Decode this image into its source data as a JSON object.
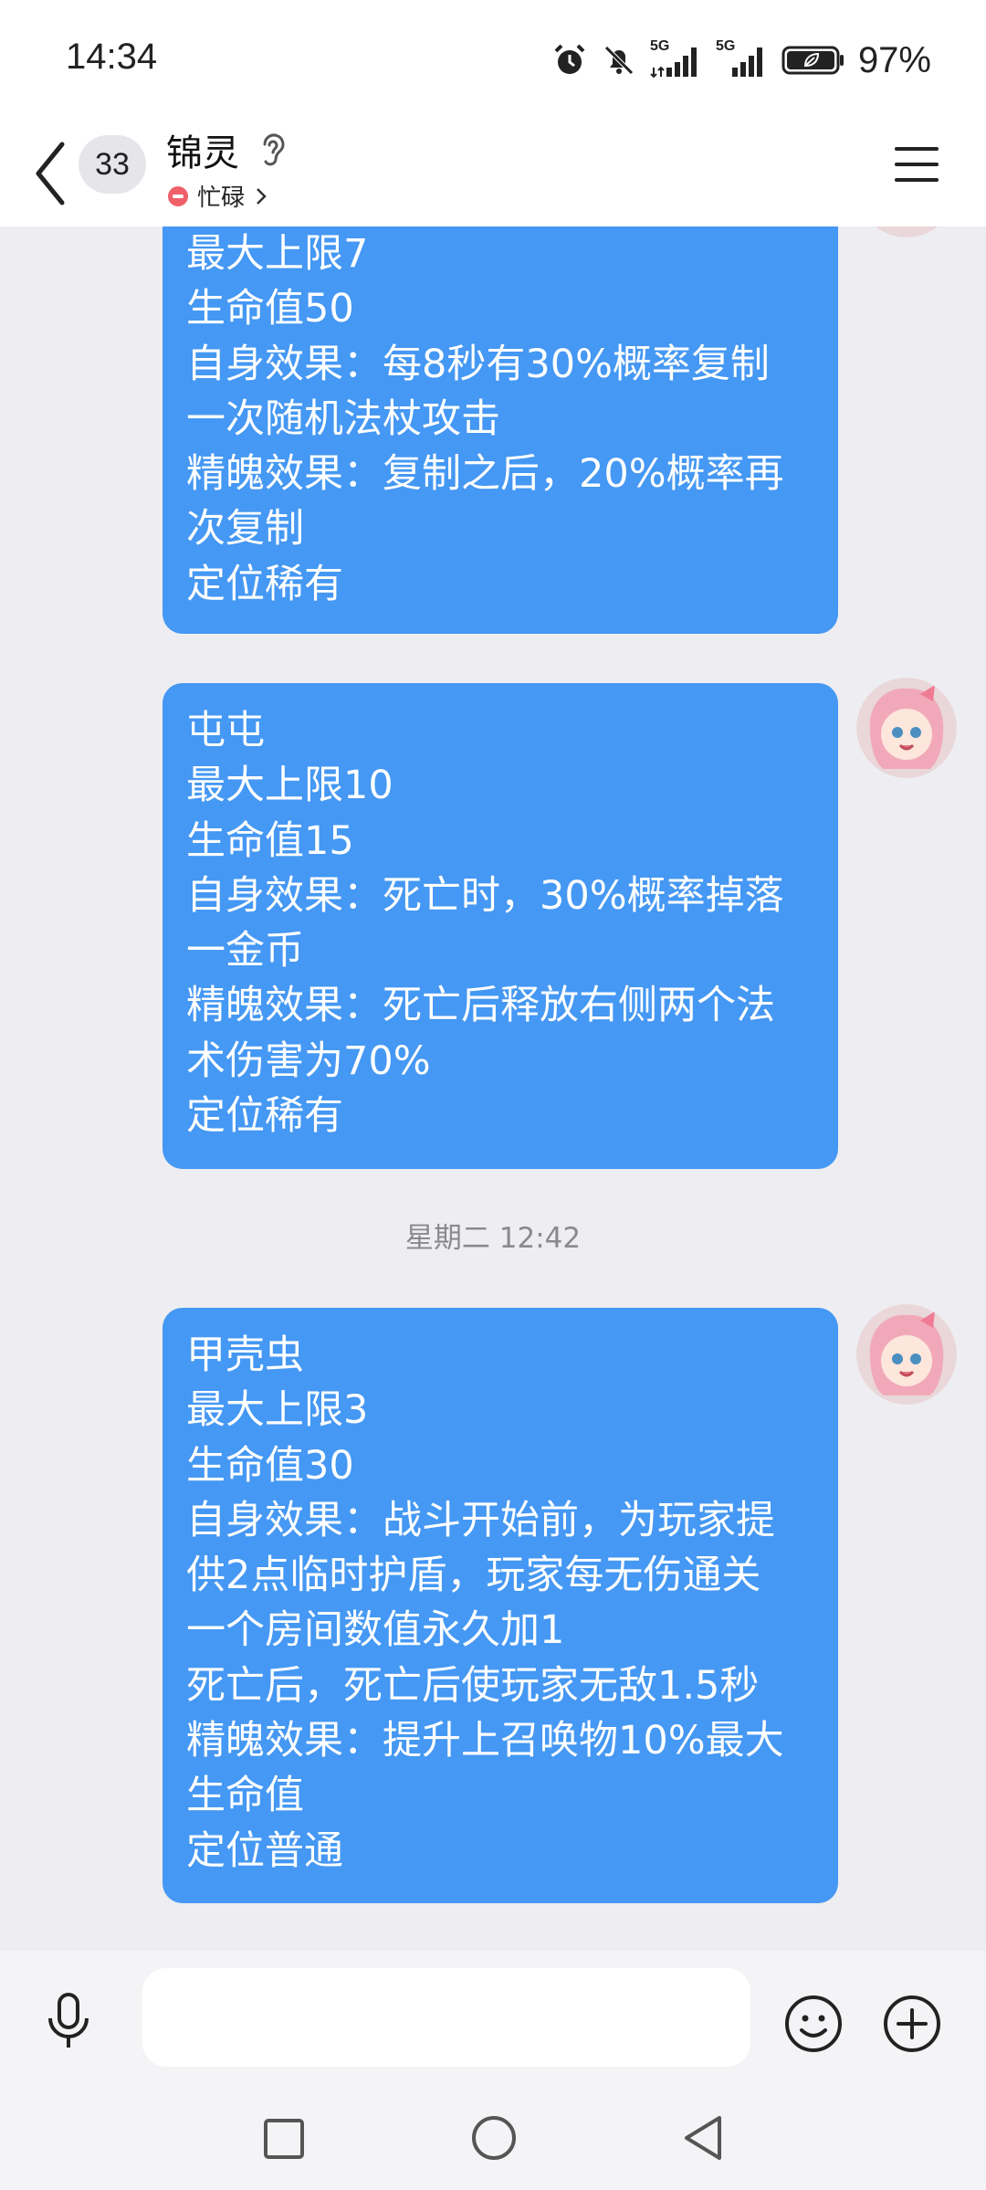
{
  "status_bar": {
    "time": "14:34",
    "network_1": "5G",
    "network_2": "5G",
    "battery": "97%"
  },
  "header": {
    "unread_count": "33",
    "contact_name": "锦灵",
    "status": "忙碌"
  },
  "messages": [
    {
      "lines": [
        "最大上限7",
        "生命值50",
        "自身效果：每8秒有30%概率复制",
        "一次随机法杖攻击",
        "精魄效果：复制之后，20%概率再",
        "次复制",
        "定位稀有"
      ]
    },
    {
      "lines": [
        "屯屯",
        "最大上限10",
        "生命值15",
        "自身效果：死亡时，30%概率掉落",
        "一金币",
        "精魄效果：死亡后释放右侧两个法",
        "术伤害为70%",
        "定位稀有"
      ]
    },
    {
      "lines": [
        "甲壳虫",
        "最大上限3",
        "生命值30",
        "自身效果：战斗开始前，为玩家提",
        "供2点临时护盾，玩家每无伤通关",
        "一个房间数值永久加1",
        "死亡后，死亡后使玩家无敌1.5秒",
        "精魄效果：提升上召唤物10%最大",
        "生命值",
        "定位普通"
      ]
    }
  ],
  "timestamp": "星期二 12:42",
  "colors": {
    "bubble": "#4598f3",
    "background": "#eeeef2",
    "busy": "#f0606a"
  },
  "icons": [
    "back-icon",
    "ear-icon",
    "menu-icon",
    "mic-icon",
    "emoji-icon",
    "plus-icon",
    "recent-apps-icon",
    "home-icon",
    "nav-back-icon"
  ]
}
